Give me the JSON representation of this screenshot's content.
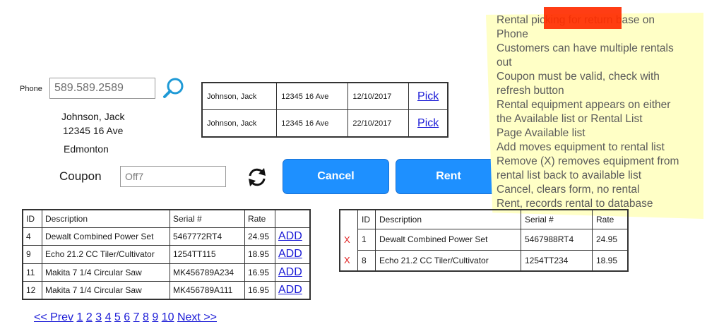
{
  "phone": {
    "label": "Phone",
    "value": "589.589.2589"
  },
  "customer": {
    "name": "Johnson, Jack",
    "address": "12345 16 Ave",
    "city": "Edmonton"
  },
  "rentals": [
    {
      "name": "Johnson, Jack",
      "address": "12345 16 Ave",
      "date": "12/10/2017",
      "action": "Pick"
    },
    {
      "name": "Johnson, Jack",
      "address": "12345 16 Ave",
      "date": "22/10/2017",
      "action": "Pick"
    }
  ],
  "coupon": {
    "label": "Coupon",
    "value": "Off7"
  },
  "buttons": {
    "cancel": "Cancel",
    "rent": "Rent"
  },
  "note": {
    "lines": [
      "Rental picking for return base on",
      "Phone",
      "Customers can have multiple rentals",
      "out",
      "Coupon must be valid, check with",
      "refresh button",
      "Rental equipment appears on either",
      "the Available list or Rental List",
      "Page Available list",
      "Add moves equipment to rental list",
      "Remove (X) removes equipment from",
      "rental list back to available list",
      "Cancel, clears form, no rental",
      "Rent, records rental to database"
    ]
  },
  "available": {
    "headers": [
      "ID",
      "Description",
      "Serial #",
      "Rate",
      ""
    ],
    "rows": [
      {
        "id": "4",
        "description": "Dewalt Combined Power Set",
        "serial": "5467772RT4",
        "rate": "24.95",
        "action": "ADD"
      },
      {
        "id": "9",
        "description": "Echo 21.2 CC Tiler/Cultivator",
        "serial": "1254TT115",
        "rate": "18.95",
        "action": "ADD"
      },
      {
        "id": "11",
        "description": "Makita 7 1/4 Circular Saw",
        "serial": "MK456789A234",
        "rate": "16.95",
        "action": "ADD"
      },
      {
        "id": "12",
        "description": "Makita 7 1/4 Circular Saw",
        "serial": "MK456789A111",
        "rate": "16.95",
        "action": "ADD"
      }
    ]
  },
  "rental_list": {
    "headers": [
      "",
      "ID",
      "Description",
      "Serial #",
      "Rate"
    ],
    "rows": [
      {
        "remove": "X",
        "id": "1",
        "description": "Dewalt Combined Power Set",
        "serial": "5467988RT4",
        "rate": "24.95"
      },
      {
        "remove": "X",
        "id": "8",
        "description": "Echo 21.2 CC Tiler/Cultivator",
        "serial": "1254TT234",
        "rate": "18.95"
      }
    ]
  },
  "pagination": {
    "prev": "<< Prev",
    "pages": [
      "1",
      "2",
      "3",
      "4",
      "5",
      "6",
      "7",
      "8",
      "9",
      "10"
    ],
    "next": "Next >>"
  },
  "colors": {
    "button": "#1e90ff",
    "note": "#ffffc6",
    "tape": "#ff2d00",
    "link": "#1a1ad6",
    "remove": "#e02020"
  },
  "icons": {
    "search": "search-icon",
    "refresh": "refresh-icon"
  }
}
